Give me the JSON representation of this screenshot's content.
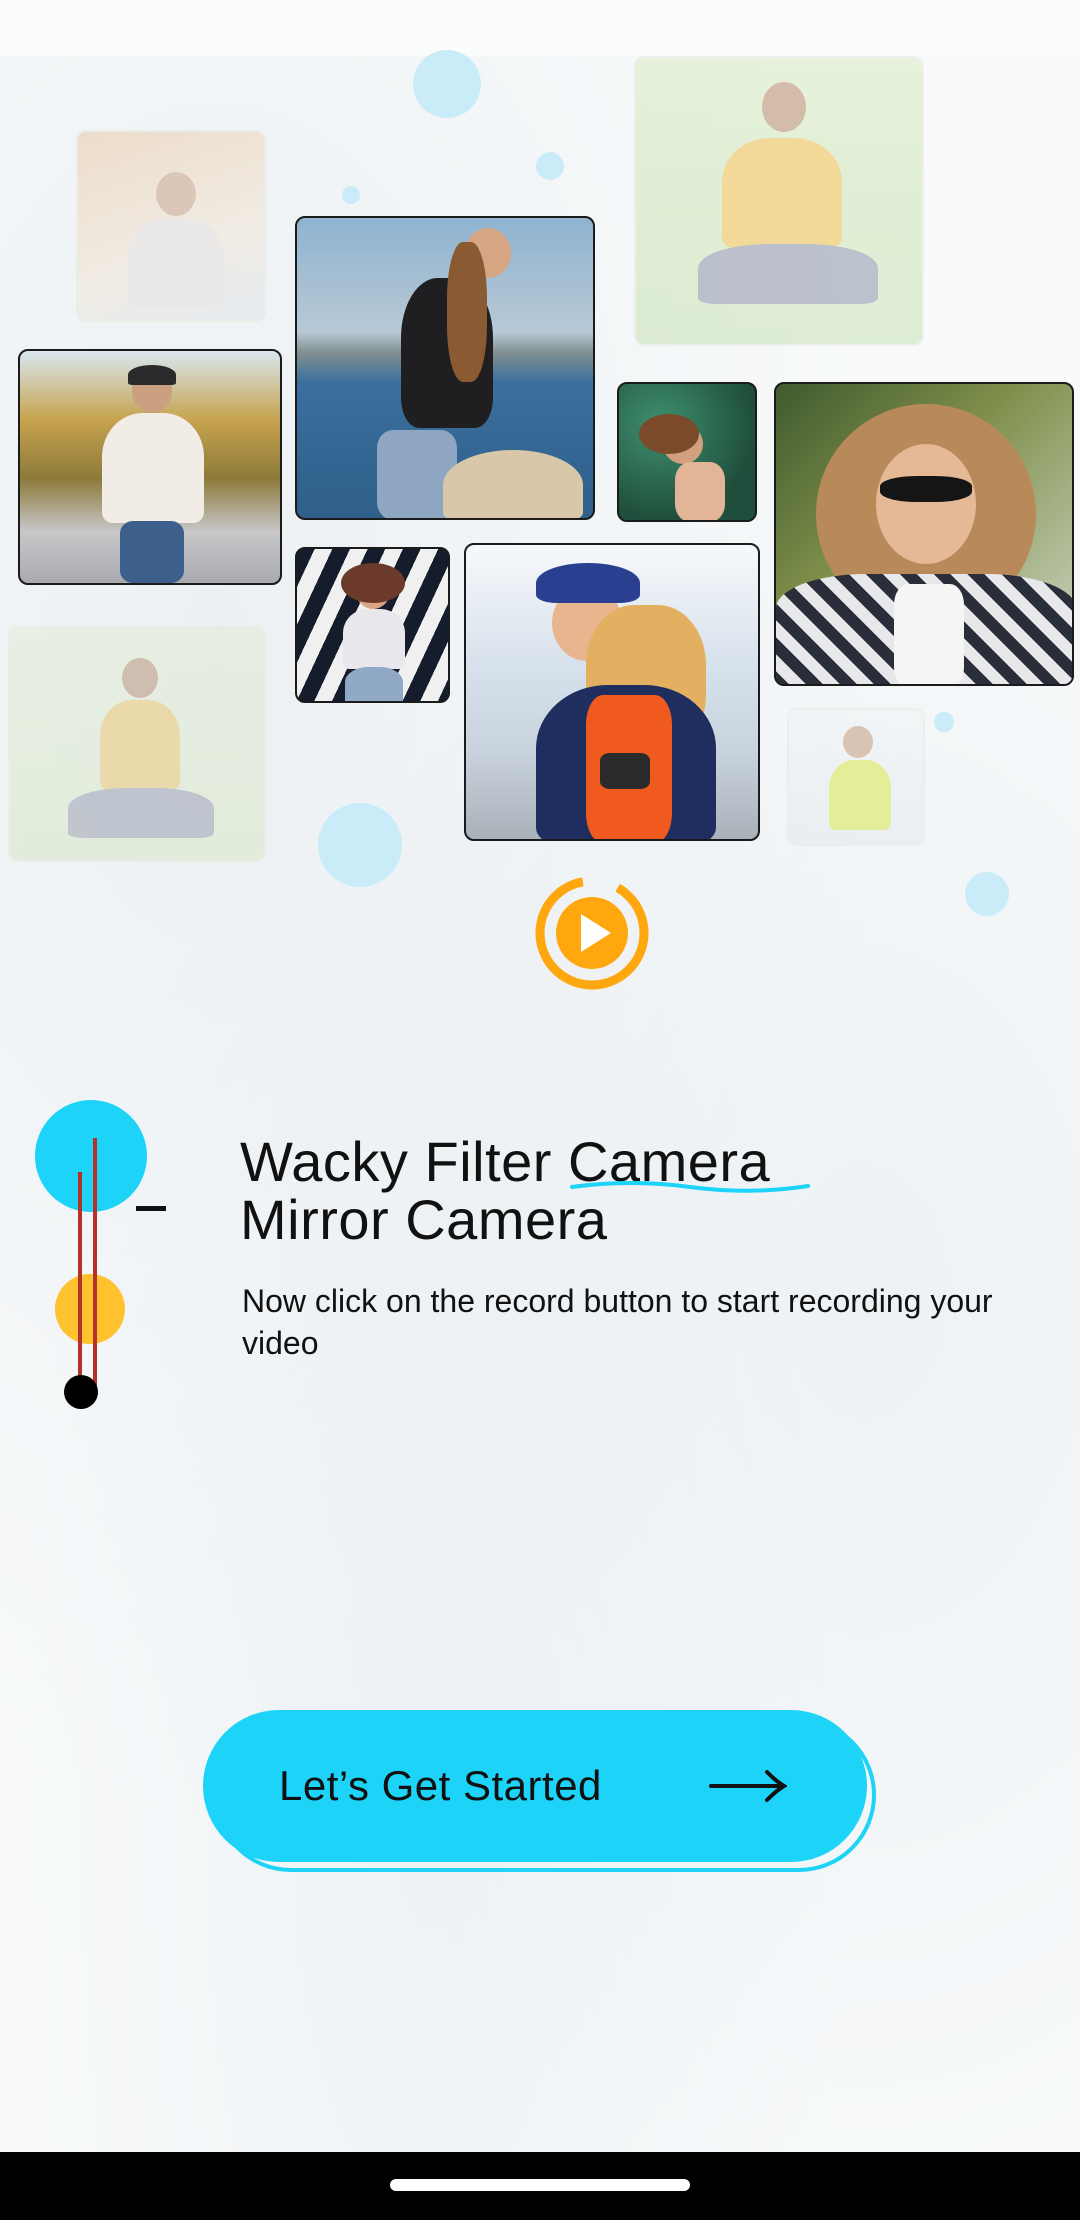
{
  "screen": {
    "title_line_1": "Wacky Filter Camera",
    "title_line_2": "Mirror Camera",
    "description": "Now click on the record button to start recording your video",
    "cta_label": "Let’s Get Started"
  },
  "icons": {
    "play": "play-circle-icon",
    "arrow": "arrow-right-icon"
  },
  "colors": {
    "accent_cyan": "#1dd3f8",
    "accent_orange": "#ffa70f",
    "accent_yellow": "#ffc12e",
    "timeline_red": "#b5322a"
  }
}
